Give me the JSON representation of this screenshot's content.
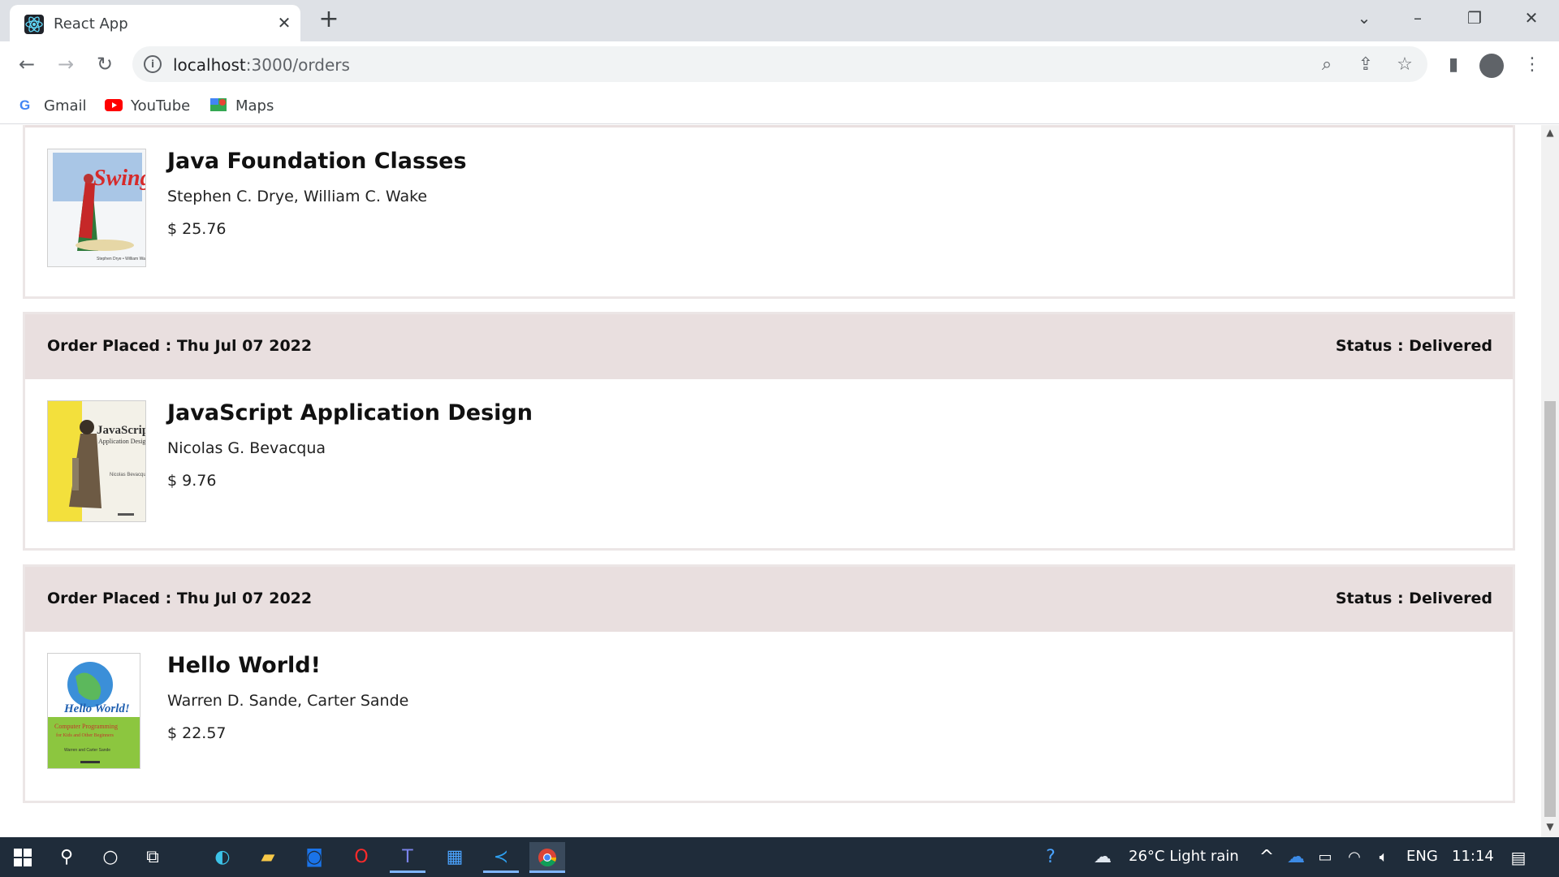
{
  "browser": {
    "tab_title": "React App",
    "url_host": "localhost",
    "url_rest": ":3000/orders",
    "bookmarks": [
      {
        "label": "Gmail"
      },
      {
        "label": "YouTube"
      },
      {
        "label": "Maps"
      }
    ]
  },
  "orders": [
    {
      "placed_label": "",
      "status_label": "",
      "book": {
        "title": "Java Foundation Classes",
        "authors": "Stephen C. Drye, William C. Wake",
        "price": "$ 25.76"
      }
    },
    {
      "placed_label": "Order Placed : Thu Jul 07 2022",
      "status_label": "Status : Delivered",
      "book": {
        "title": "JavaScript Application Design",
        "authors": "Nicolas G. Bevacqua",
        "price": "$ 9.76"
      }
    },
    {
      "placed_label": "Order Placed : Thu Jul 07 2022",
      "status_label": "Status : Delivered",
      "book": {
        "title": "Hello World!",
        "authors": "Warren D. Sande, Carter Sande",
        "price": "$ 22.57"
      }
    }
  ],
  "taskbar": {
    "weather": "26°C  Light rain",
    "language": "ENG",
    "time": "11:14"
  },
  "icons": {
    "favicon": "react-icon",
    "close": "close-icon",
    "new_tab": "plus-icon"
  },
  "colors": {
    "card_header": "#e9dfdf",
    "card_border": "#ece6e6",
    "taskbar": "#1f2c3a"
  }
}
